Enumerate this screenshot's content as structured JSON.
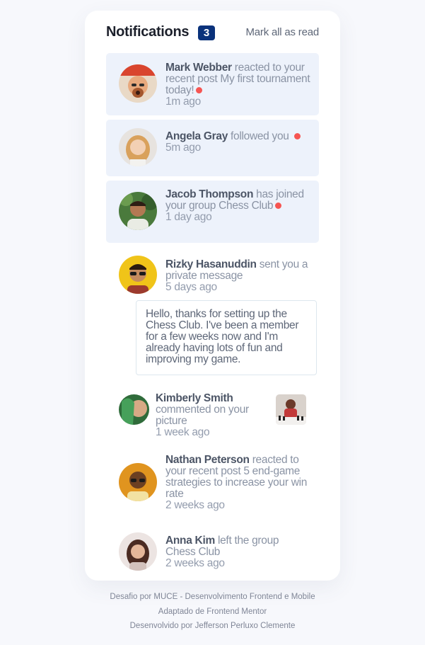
{
  "header": {
    "title": "Notifications",
    "unread_count": "3",
    "mark_all_label": "Mark all as read"
  },
  "colors": {
    "accent": "#0a327b",
    "unread_bg": "#edf2fb",
    "dot": "#f65552"
  },
  "notifications": [
    {
      "name": "Mark Webber",
      "action": "reacted to your recent post",
      "object": "My first tournament today!",
      "time": "1m ago",
      "unread": true
    },
    {
      "name": "Angela Gray",
      "action": "followed you",
      "object": "",
      "time": "5m ago",
      "unread": true
    },
    {
      "name": "Jacob Thompson",
      "action": "has joined your group",
      "object": "Chess Club",
      "time": "1 day ago",
      "unread": true
    },
    {
      "name": "Rizky Hasanuddin",
      "action": "sent you a private message",
      "object": "",
      "time": "5 days ago",
      "unread": false,
      "message": "Hello, thanks for setting up the Chess Club. I've been a member for a few weeks now and I'm already having lots of fun and improving my game."
    },
    {
      "name": "Kimberly Smith",
      "action": "commented on your picture",
      "object": "",
      "time": "1 week ago",
      "unread": false
    },
    {
      "name": "Nathan Peterson",
      "action": "reacted to your recent post",
      "object": "5 end-game strategies to increase your win rate",
      "time": "2 weeks ago",
      "unread": false
    },
    {
      "name": "Anna Kim",
      "action": "left the group",
      "object": "Chess Club",
      "time": "2 weeks ago",
      "unread": false
    }
  ],
  "footer": {
    "line1": "Desafio por MUCE - Desenvolvimento Frontend e Mobile",
    "line2": "Adaptado de Frontend Mentor",
    "line3": "Desenvolvido por Jefferson Perluxo Clemente"
  }
}
